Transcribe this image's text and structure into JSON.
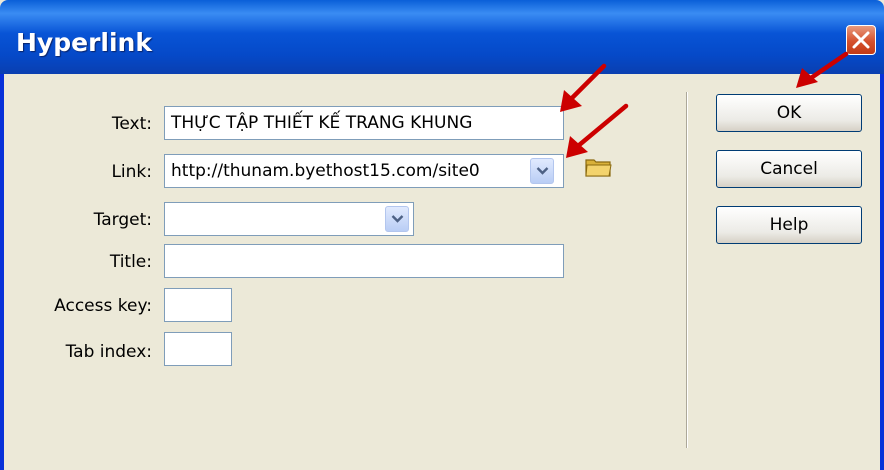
{
  "window": {
    "title": "Hyperlink"
  },
  "form": {
    "text_label": "Text:",
    "text_value": "THỰC TẬP THIẾT KẾ TRANG KHUNG",
    "link_label": "Link:",
    "link_value": "http://thunam.byethost15.com/site0",
    "target_label": "Target:",
    "target_value": "",
    "title_label": "Title:",
    "title_value": "",
    "access_key_label": "Access key:",
    "access_key_value": "",
    "tab_index_label": "Tab index:",
    "tab_index_value": ""
  },
  "buttons": {
    "ok": "OK",
    "cancel": "Cancel",
    "help": "Help"
  },
  "icons": [
    "close-icon",
    "chevron-down-icon",
    "folder-icon",
    "red-arrow-annotation"
  ],
  "colors": {
    "titlebar": "#0a54d6",
    "client": "#ece9d8",
    "close": "#d5512e",
    "annotation": "#cc0000"
  }
}
